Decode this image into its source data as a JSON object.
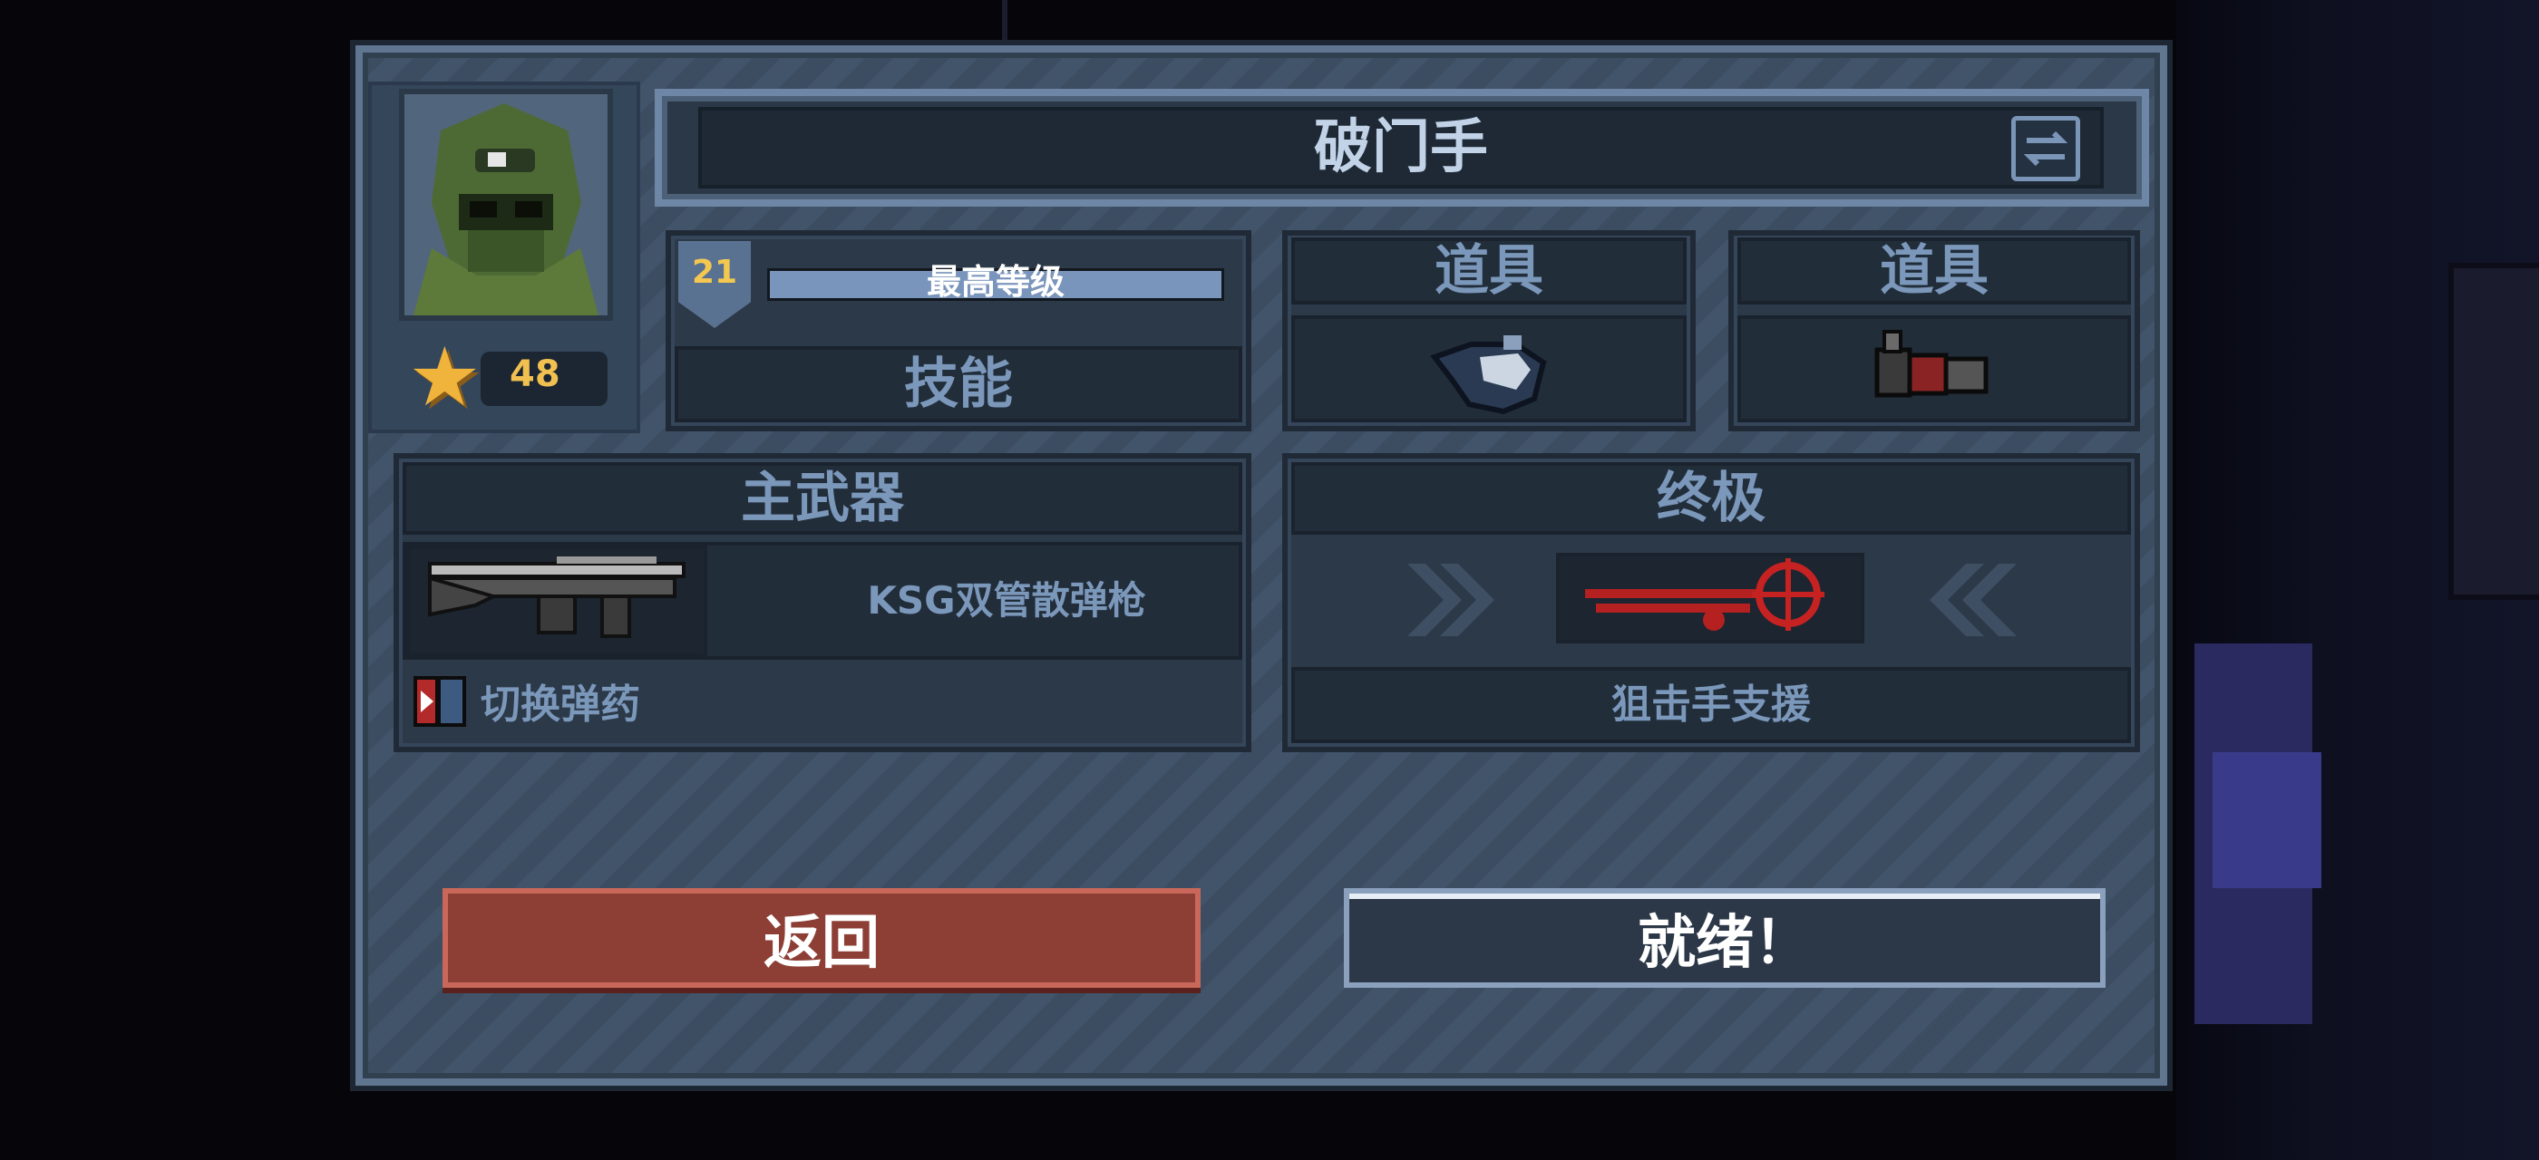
{
  "character": {
    "name": "破门手",
    "star_count": "48",
    "level": "21",
    "level_progress": 1.0,
    "level_status": "最高等级",
    "skill_label": "技能"
  },
  "items": [
    {
      "label": "道具",
      "icon": "shield-flask-icon"
    },
    {
      "label": "道具",
      "icon": "shell-icon"
    }
  ],
  "primary_weapon": {
    "header": "主武器",
    "name": "KSG双管散弹枪",
    "icon": "shotgun-icon",
    "ammo_label": "切换弹药",
    "ammo_icon": "ammo-icon"
  },
  "ultimate": {
    "header": "终极",
    "name": "狙击手支援",
    "icon": "sniper-crosshair-icon"
  },
  "buttons": {
    "back": "返回",
    "ready": "就绪！"
  },
  "colors": {
    "panel": "#3c4d62",
    "accent_blue": "#7b98bb",
    "back_red": "#8d3f36",
    "gold": "#f0c050"
  }
}
